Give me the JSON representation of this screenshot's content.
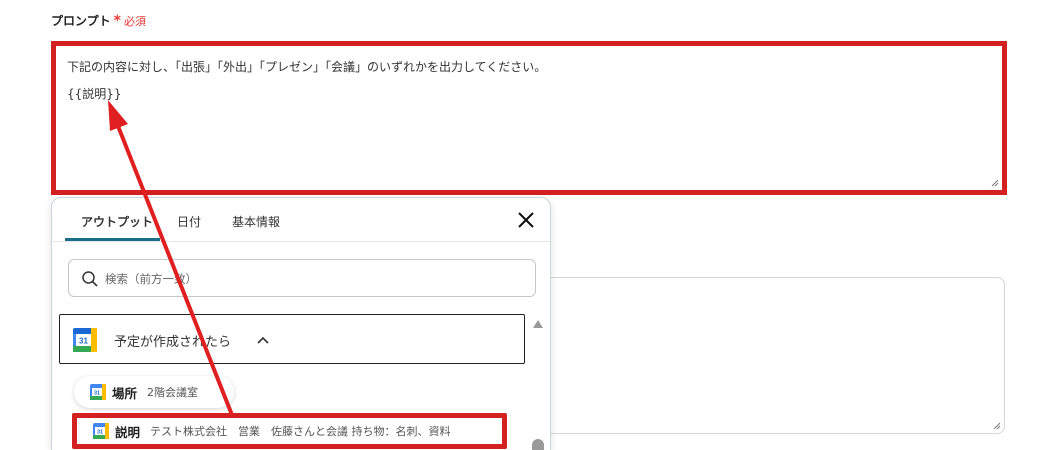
{
  "field": {
    "label": "プロンプト",
    "required_star": "*",
    "required_text": "必須"
  },
  "prompt": {
    "line1": "下記の内容に対し、「出張」「外出」「プレゼン」「会議」のいずれかを出力してください。",
    "line2": "{{説明}}"
  },
  "popup": {
    "tabs": [
      {
        "label": "アウトプット"
      },
      {
        "label": "日付"
      },
      {
        "label": "基本情報"
      }
    ],
    "search": {
      "placeholder": "検索（前方一致）"
    },
    "trigger": {
      "label": "予定が作成されたら",
      "icon": "google-calendar-icon"
    },
    "items": [
      {
        "key": "場所",
        "value": "2階会議室",
        "icon": "google-calendar-icon"
      },
      {
        "key": "説明",
        "value": "テスト株式会社　営業　佐藤さんと会議 持ち物：名刺、資料",
        "icon": "google-calendar-icon"
      }
    ]
  },
  "colors": {
    "highlight": "#d32020",
    "accent": "#1a6e8a",
    "required": "#e53935"
  }
}
